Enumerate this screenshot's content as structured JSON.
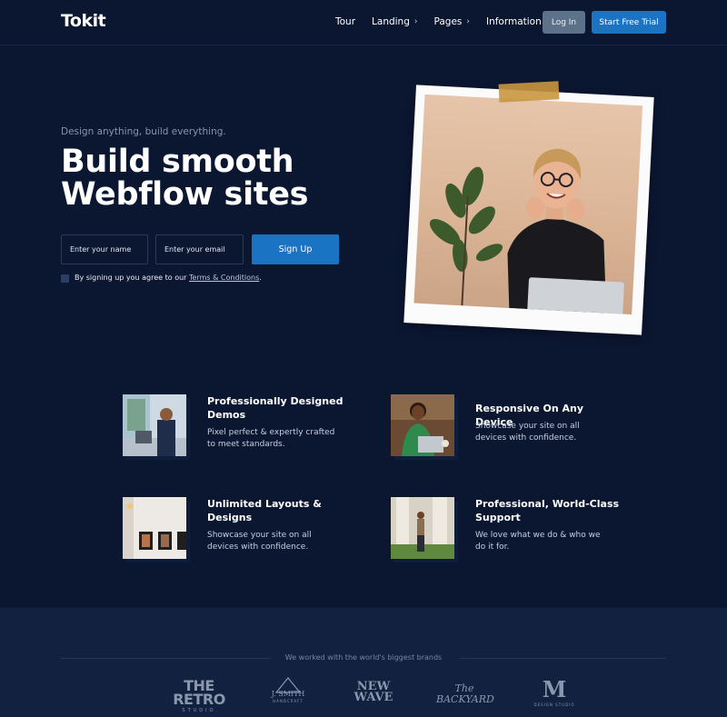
{
  "nav": {
    "logo": "Tokit",
    "links": [
      {
        "label": "Tour",
        "caret": false
      },
      {
        "label": "Landing",
        "caret": true
      },
      {
        "label": "Pages",
        "caret": true
      },
      {
        "label": "Information",
        "caret": true
      }
    ],
    "login_label": "Log In",
    "trial_label": "Start Free Trial"
  },
  "hero": {
    "subtitle": "Design anything, build everything.",
    "title_line1": "Build smooth",
    "title_line2": "Webflow sites",
    "name_placeholder": "Enter your name",
    "email_placeholder": "Enter your email",
    "signup_label": "Sign Up",
    "terms_prefix": "By signing up you agree to our ",
    "terms_link": "Terms & Conditions",
    "terms_suffix": "."
  },
  "features": [
    {
      "title": "Professionally Designed Demos",
      "desc": "Pixel perfect & expertly crafted to meet standards."
    },
    {
      "title": "Responsive On Any Device",
      "desc": "Showcase your site on all devices with confidence."
    },
    {
      "title": "Unlimited Layouts & Designs",
      "desc": "Showcase your site on all devices with confidence."
    },
    {
      "title": "Professional, World-Class Support",
      "desc": "We love what we do & who we do it for."
    }
  ],
  "brands": {
    "label": "We worked with the world's biggest brands",
    "items": [
      {
        "main": "THE RETRO",
        "sub": "STUDIO"
      },
      {
        "main": "J. SMITH",
        "sub": "HANDCRAFT"
      },
      {
        "main": "NEW WAVE",
        "sub": ""
      },
      {
        "main": "The BACKYARD",
        "sub": ""
      },
      {
        "main": "M",
        "sub": "DESIGN STUDIO"
      }
    ]
  },
  "colors": {
    "background": "#0b1631",
    "accent": "#1b73c4",
    "login_button": "#5d7189",
    "brands_band": "#12213f"
  }
}
